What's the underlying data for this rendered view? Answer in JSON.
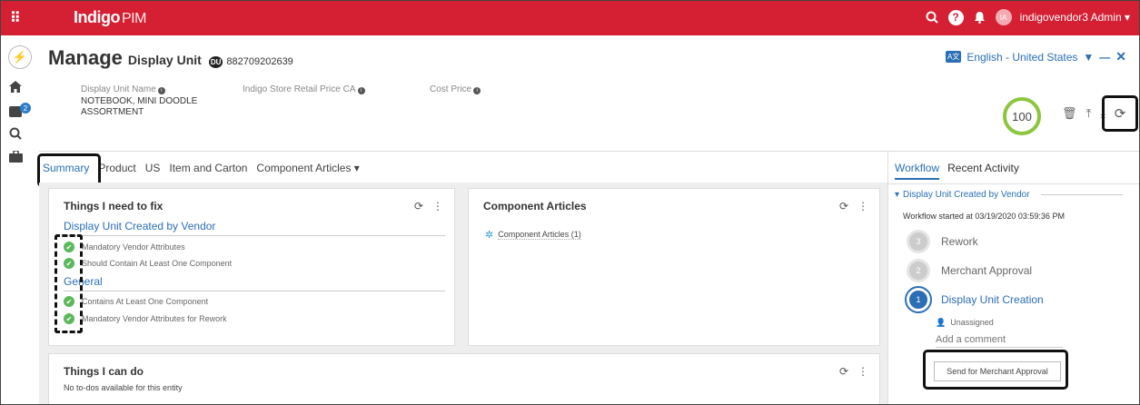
{
  "topbar": {
    "logo": "Indigo",
    "logo_suffix": "PIM",
    "user": "indigovendor3 Admin ▾",
    "avatar": "IA",
    "icons": [
      "grid-icon",
      "search-icon",
      "help-icon",
      "bell-icon",
      "avatar",
      "chevron-down-icon"
    ]
  },
  "rail": {
    "badge": "2",
    "icons": [
      "lightning-icon",
      "home-icon",
      "inbox-icon",
      "search-icon",
      "briefcase-icon"
    ]
  },
  "header": {
    "title": "Manage",
    "entity": "Display Unit",
    "type_badge": "DU",
    "code": "882709202639",
    "language": "English - United States"
  },
  "fields": [
    {
      "label": "Display Unit Name",
      "value": "NOTEBOOK, MINI DOODLE ASSORTMENT"
    },
    {
      "label": "Indigo Store Retail Price CA",
      "value": ""
    },
    {
      "label": "Cost Price",
      "value": ""
    }
  ],
  "score": "100",
  "tabs": [
    {
      "label": "Summary",
      "active": true
    },
    {
      "label": "Product"
    },
    {
      "label": "US"
    },
    {
      "label": "Item and Carton"
    },
    {
      "label": "Component Articles ▾"
    }
  ],
  "fix_card": {
    "title": "Things I need to fix",
    "sections": [
      {
        "title": "Display Unit Created by Vendor",
        "items": [
          "Mandatory Vendor Attributes",
          "Should Contain At Least One Component"
        ]
      },
      {
        "title": "General",
        "items": [
          "Contains At Least One Component",
          "Mandatory Vendor Attributes for Rework"
        ]
      }
    ]
  },
  "component_card": {
    "title": "Component Articles",
    "link": "Component Articles (1)"
  },
  "todo_card": {
    "title": "Things I can do",
    "text": "No to-dos available for this entity"
  },
  "workflow": {
    "tabs": [
      "Workflow",
      "Recent Activity"
    ],
    "section": "Display Unit Created by Vendor",
    "started": "Workflow started at 03/19/2020 03:59:36 PM",
    "steps": [
      {
        "n": "3",
        "label": "Rework"
      },
      {
        "n": "2",
        "label": "Merchant Approval"
      },
      {
        "n": "1",
        "label": "Display Unit Creation",
        "current": true
      }
    ],
    "assignee": "Unassigned",
    "comment_placeholder": "Add a comment",
    "send_button": "Send for Merchant Approval"
  }
}
